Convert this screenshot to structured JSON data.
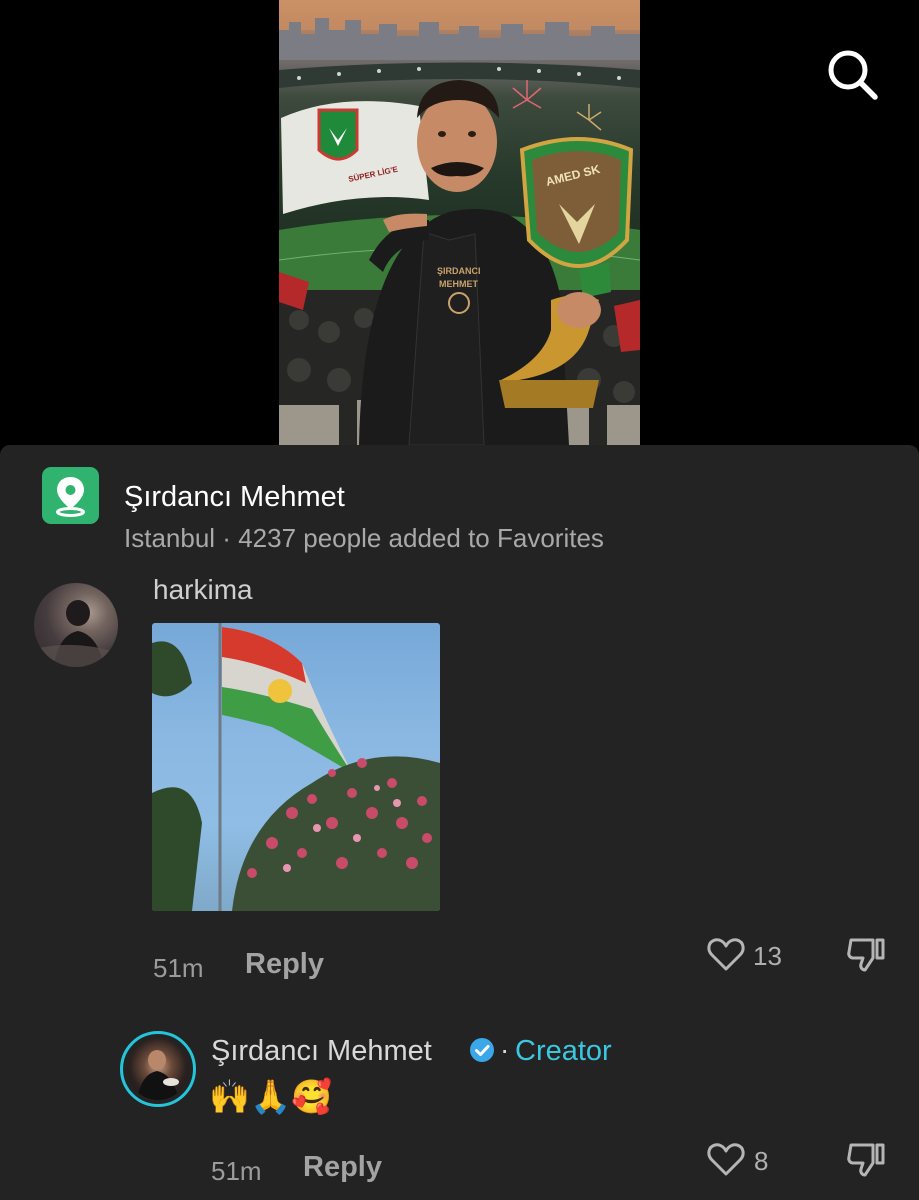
{
  "header": {
    "search_icon": "search-icon"
  },
  "place": {
    "icon": "location-pin-icon",
    "icon_color": "#2fb36f",
    "title": "Şırdancı Mehmet",
    "city": "Istanbul",
    "separator": " · ",
    "favorites": "4237 people added to Favorites"
  },
  "comments": [
    {
      "username": "harkima",
      "time": "51m",
      "reply_label": "Reply",
      "likes": "13"
    },
    {
      "username": "Şırdancı Mehmet",
      "badge_separator": "·",
      "creator_label": "Creator",
      "text": "🙌🙏🥰",
      "time": "51m",
      "reply_label": "Reply",
      "likes": "8"
    }
  ],
  "colors": {
    "sheet_bg": "#232323",
    "creator_accent": "#3cc6e0",
    "verified_badge": "#3aa7e8"
  }
}
